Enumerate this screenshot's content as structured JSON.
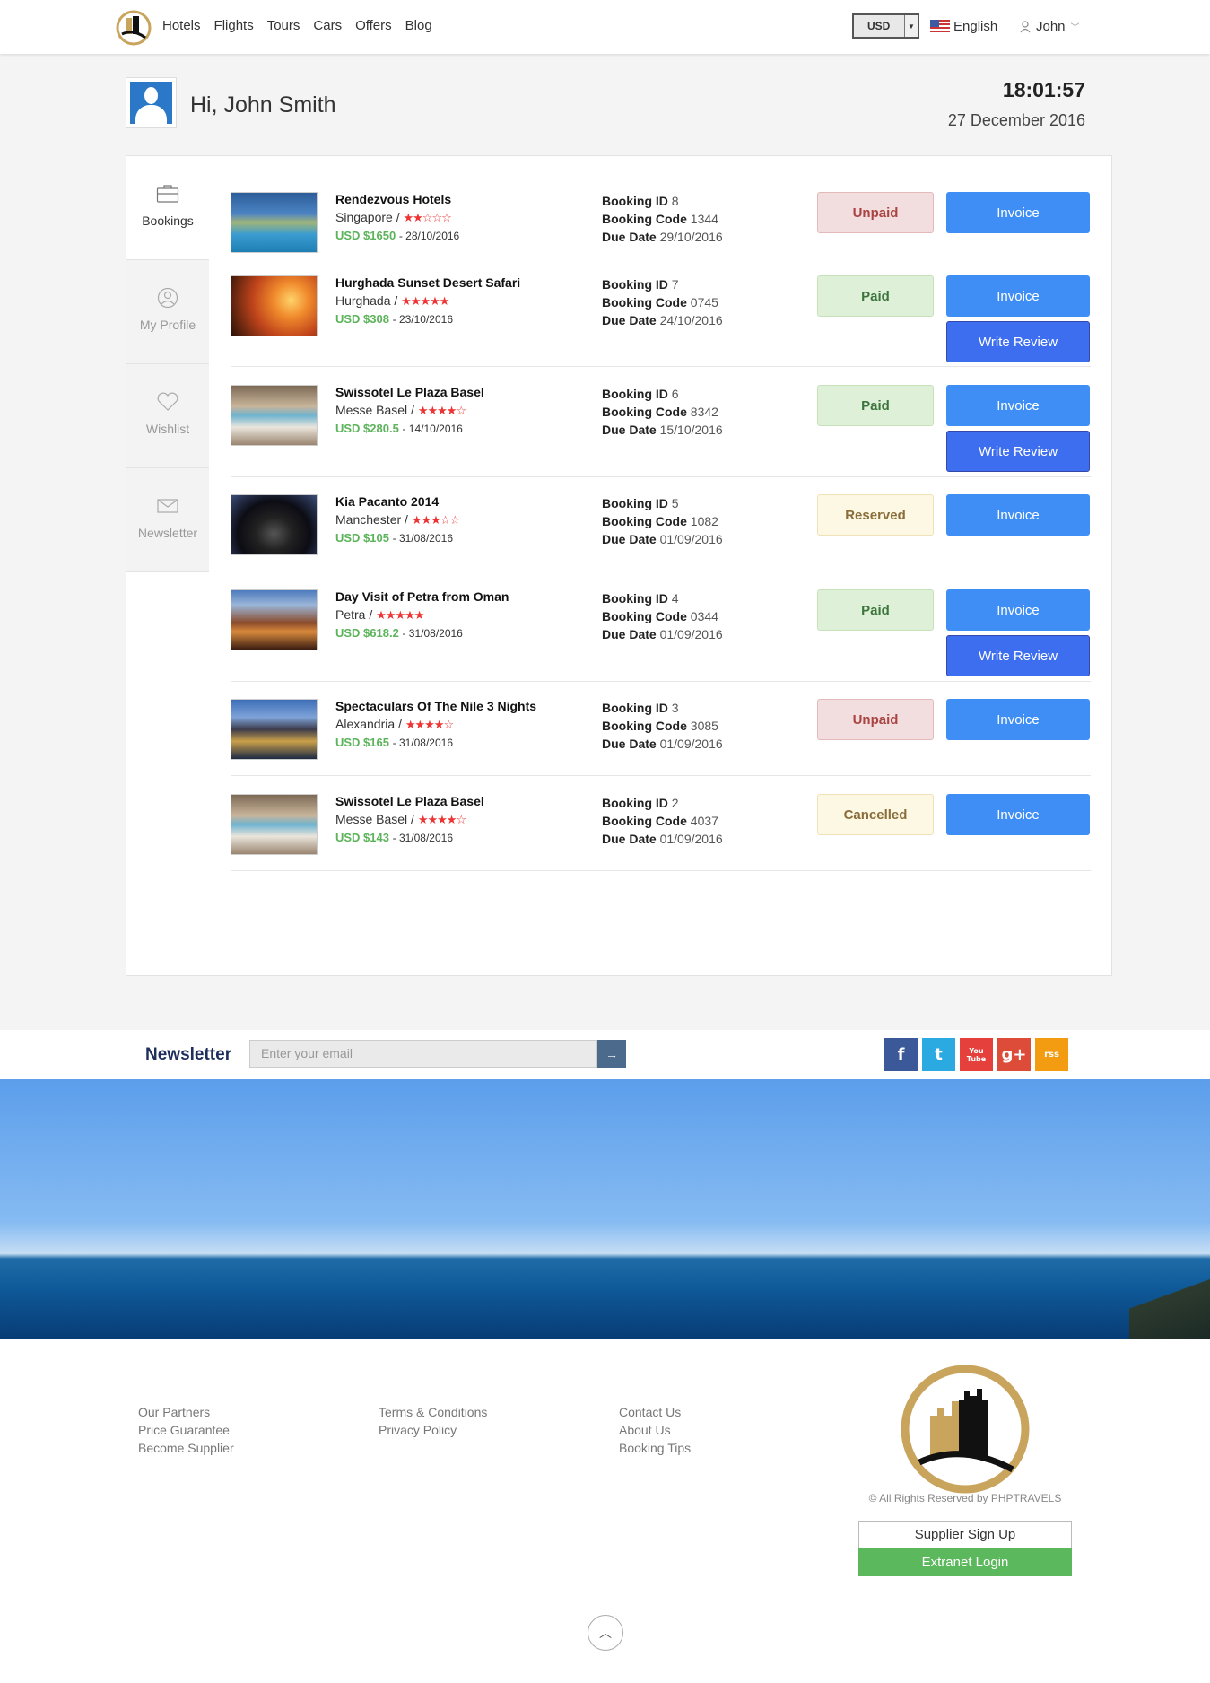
{
  "nav": {
    "items": [
      "Hotels",
      "Flights",
      "Tours",
      "Cars",
      "Offers",
      "Blog"
    ]
  },
  "header": {
    "currency": "USD",
    "language": "English",
    "user": "John"
  },
  "greeting": {
    "text": "Hi, John Smith",
    "time": "18:01:57",
    "date": "27 December 2016"
  },
  "sidebar": {
    "items": [
      "Bookings",
      "My Profile",
      "Wishlist",
      "Newsletter"
    ]
  },
  "labels": {
    "booking_id": "Booking ID",
    "booking_code": "Booking Code",
    "due_date": "Due Date",
    "invoice": "Invoice",
    "write_review": "Write Review"
  },
  "bookings": [
    {
      "title": "Rendezvous Hotels",
      "location": "Singapore /",
      "stars": "★★☆☆☆",
      "price": "USD $1650",
      "date": "- 28/10/2016",
      "id": "8",
      "code": "1344",
      "due": "29/10/2016",
      "status": "Unpaid"
    },
    {
      "title": "Hurghada Sunset Desert Safari",
      "location": "Hurghada /",
      "stars": "★★★★★",
      "price": "USD $308",
      "date": "- 23/10/2016",
      "id": "7",
      "code": "0745",
      "due": "24/10/2016",
      "status": "Paid"
    },
    {
      "title": "Swissotel Le Plaza Basel",
      "location": "Messe Basel /",
      "stars": "★★★★☆",
      "price": "USD $280.5",
      "date": "- 14/10/2016",
      "id": "6",
      "code": "8342",
      "due": "15/10/2016",
      "status": "Paid"
    },
    {
      "title": "Kia Pacanto 2014",
      "location": "Manchester /",
      "stars": "★★★☆☆",
      "price": "USD $105",
      "date": "- 31/08/2016",
      "id": "5",
      "code": "1082",
      "due": "01/09/2016",
      "status": "Reserved"
    },
    {
      "title": "Day Visit of Petra from Oman",
      "location": "Petra /",
      "stars": "★★★★★",
      "price": "USD $618.2",
      "date": "- 31/08/2016",
      "id": "4",
      "code": "0344",
      "due": "01/09/2016",
      "status": "Paid"
    },
    {
      "title": "Spectaculars Of The Nile 3 Nights",
      "location": "Alexandria /",
      "stars": "★★★★☆",
      "price": "USD $165",
      "date": "- 31/08/2016",
      "id": "3",
      "code": "3085",
      "due": "01/09/2016",
      "status": "Unpaid"
    },
    {
      "title": "Swissotel Le Plaza Basel",
      "location": "Messe Basel /",
      "stars": "★★★★☆",
      "price": "USD $143",
      "date": "- 31/08/2016",
      "id": "2",
      "code": "4037",
      "due": "01/09/2016",
      "status": "Cancelled"
    }
  ],
  "newsletter": {
    "label": "Newsletter",
    "placeholder": "Enter your email"
  },
  "social": [
    "f",
    "t",
    "You Tube",
    "g+",
    "rss"
  ],
  "footer": {
    "col1": [
      "Our Partners",
      "Price Guarantee",
      "Become Supplier"
    ],
    "col2": [
      "Terms & Conditions",
      "Privacy Policy"
    ],
    "col3": [
      "Contact Us",
      "About Us",
      "Booking Tips"
    ],
    "copyright": "© All Rights Reserved by PHPTRAVELS",
    "supplier": "Supplier Sign Up",
    "extranet": "Extranet Login"
  },
  "colors": {
    "primary": "#3e8ef5",
    "price": "#5bb35a",
    "gold": "#c9a45c"
  }
}
